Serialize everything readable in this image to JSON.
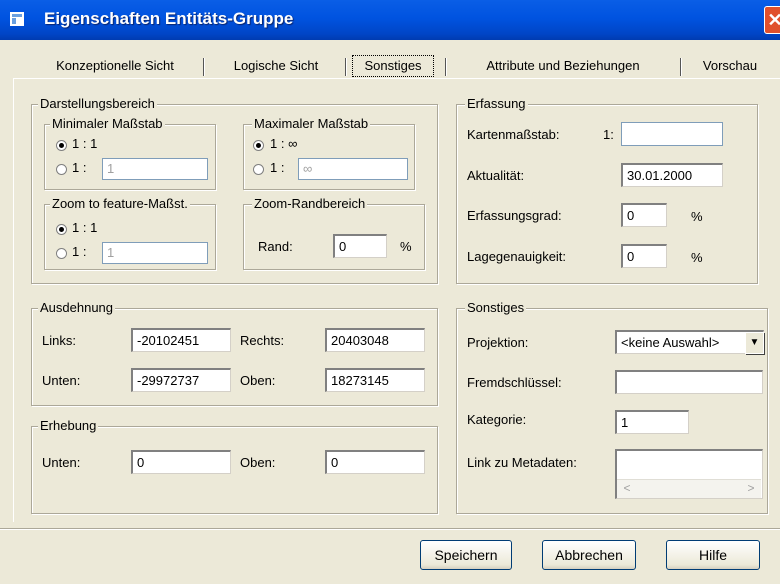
{
  "window": {
    "title": "Eigenschaften Entitäts-Gruppe",
    "close_glyph": "✕"
  },
  "tabs": [
    "Konzeptionelle Sicht",
    "Logische Sicht",
    "Sonstiges",
    "Attribute und Beziehungen",
    "Vorschau"
  ],
  "darstellung": {
    "label": "Darstellungsbereich",
    "min": {
      "label": "Minimaler Maßstab",
      "opt1": "1 : 1",
      "opt2": "1 :",
      "value": "1"
    },
    "max": {
      "label": "Maximaler Maßstab",
      "opt1": "1 : ∞",
      "opt2": "1 :",
      "value": "∞"
    },
    "zoom": {
      "label": "Zoom to feature-Maßst.",
      "opt1": "1 : 1",
      "opt2": "1 :",
      "value": "1"
    },
    "rand": {
      "label": "Zoom-Randbereich",
      "field_label": "Rand:",
      "value": "0",
      "unit": "%"
    }
  },
  "erfassung": {
    "label": "Erfassung",
    "kartenmassstab": {
      "label": "Kartenmaßstab:",
      "prefix": "1:",
      "value": ""
    },
    "aktualitaet": {
      "label": "Aktualität:",
      "value": "30.01.2000"
    },
    "erfassungsgrad": {
      "label": "Erfassungsgrad:",
      "value": "0",
      "unit": "%"
    },
    "lagegenauigkeit": {
      "label": "Lagegenauigkeit:",
      "value": "0",
      "unit": "%"
    }
  },
  "ausdehnung": {
    "label": "Ausdehnung",
    "links": {
      "label": "Links:",
      "value": "-20102451"
    },
    "rechts": {
      "label": "Rechts:",
      "value": "20403048"
    },
    "unten": {
      "label": "Unten:",
      "value": "-29972737"
    },
    "oben": {
      "label": "Oben:",
      "value": "18273145"
    }
  },
  "erhebung": {
    "label": "Erhebung",
    "unten": {
      "label": "Unten:",
      "value": "0"
    },
    "oben": {
      "label": "Oben:",
      "value": "0"
    }
  },
  "sonstiges": {
    "label": "Sonstiges",
    "projektion": {
      "label": "Projektion:",
      "value": "<keine Auswahl>"
    },
    "fremdschluessel": {
      "label": "Fremdschlüssel:",
      "value": ""
    },
    "kategorie": {
      "label": "Kategorie:",
      "value": "1"
    },
    "link": {
      "label": "Link zu Metadaten:",
      "value": ""
    }
  },
  "buttons": {
    "save": "Speichern",
    "cancel": "Abbrechen",
    "help": "Hilfe"
  },
  "colors": {
    "titlebar": "#0053e0",
    "face": "#ece9d8",
    "input_border": "#7f9db9"
  }
}
